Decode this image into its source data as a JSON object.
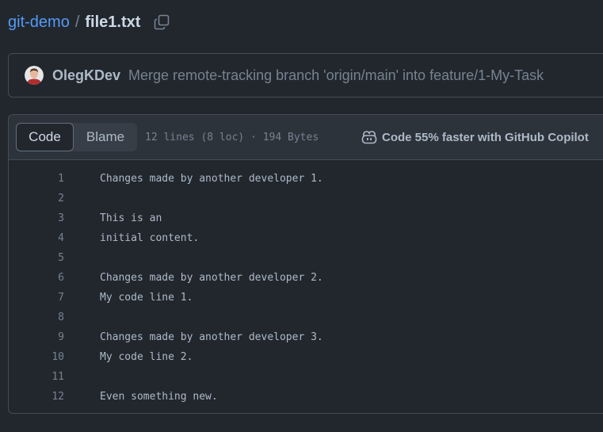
{
  "breadcrumb": {
    "repo": "git-demo",
    "separator": "/",
    "file": "file1.txt",
    "copy_icon": "copy-icon"
  },
  "commit": {
    "author": "OlegKDev",
    "message": "Merge remote-tracking branch 'origin/main' into feature/1-My-Task",
    "avatar_icon": "user-avatar"
  },
  "file_header": {
    "tabs": [
      {
        "label": "Code",
        "active": true
      },
      {
        "label": "Blame",
        "active": false
      }
    ],
    "meta": "12 lines (8 loc) · 194 Bytes",
    "copilot_label": "Code 55% faster with GitHub Copilot",
    "copilot_icon": "copilot-icon"
  },
  "code": {
    "lines": [
      {
        "num": "1",
        "text": "Changes made by another developer 1."
      },
      {
        "num": "2",
        "text": ""
      },
      {
        "num": "3",
        "text": "This is an"
      },
      {
        "num": "4",
        "text": "initial content."
      },
      {
        "num": "5",
        "text": ""
      },
      {
        "num": "6",
        "text": "Changes made by another developer 2."
      },
      {
        "num": "7",
        "text": "My code line 1."
      },
      {
        "num": "8",
        "text": ""
      },
      {
        "num": "9",
        "text": "Changes made by another developer 3."
      },
      {
        "num": "10",
        "text": "My code line 2."
      },
      {
        "num": "11",
        "text": ""
      },
      {
        "num": "12",
        "text": "Even something new."
      }
    ]
  },
  "colors": {
    "background": "#22272e",
    "link": "#539bf5",
    "border": "#444c56",
    "header_bg": "#2d333b"
  }
}
